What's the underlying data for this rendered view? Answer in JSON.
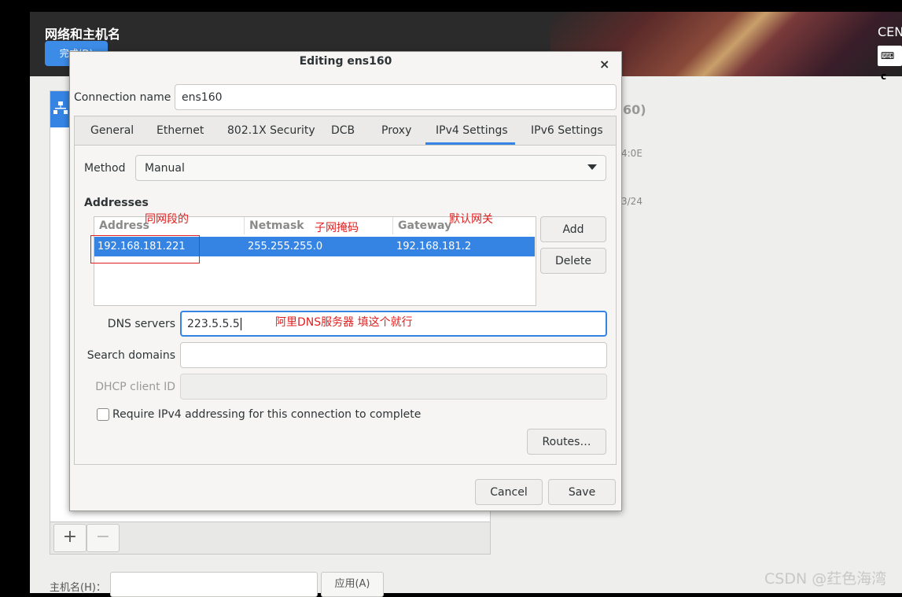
{
  "background": {
    "title": "网络和主机名",
    "done_label": "完成(D)",
    "product": "CEN",
    "keyboard_layout": "c",
    "side_snippets": [
      "60)",
      "4:0E",
      "3/24"
    ],
    "hostname_label": "主机名(H)：",
    "apply_label": "应用(A)",
    "add_symbol": "+",
    "remove_symbol": "−"
  },
  "dialog": {
    "title": "Editing ens160",
    "close_symbol": "×",
    "connection_name_label": "Connection name",
    "connection_name_value": "ens160",
    "tabs": [
      "General",
      "Ethernet",
      "802.1X Security",
      "DCB",
      "Proxy",
      "IPv4 Settings",
      "IPv6 Settings"
    ],
    "active_tab": "IPv4 Settings",
    "method_label": "Method",
    "method_value": "Manual",
    "addresses_heading": "Addresses",
    "columns": [
      "Address",
      "Netmask",
      "Gateway"
    ],
    "rows": [
      {
        "address": "192.168.181.221",
        "netmask": "255.255.255.0",
        "gateway": "192.168.181.2"
      }
    ],
    "add_label": "Add",
    "delete_label": "Delete",
    "dns_label": "DNS servers",
    "dns_value": "223.5.5.5",
    "search_domains_label": "Search domains",
    "dhcp_client_id_label": "DHCP client ID",
    "require_ipv4_label": "Require IPv4 addressing for this connection to complete",
    "require_ipv4_checked": false,
    "routes_label": "Routes…",
    "cancel_label": "Cancel",
    "save_label": "Save"
  },
  "annotations": {
    "same_segment": "同网段的",
    "subnet_mask": "子网掩码",
    "default_gateway": "默认网关",
    "dns_note": "阿里DNS服务器 填这个就行",
    "color": "#e02020"
  },
  "watermark": "CSDN @荭色海湾",
  "colors": {
    "accent": "#3584e4",
    "done_button": "#3c8ce7"
  }
}
